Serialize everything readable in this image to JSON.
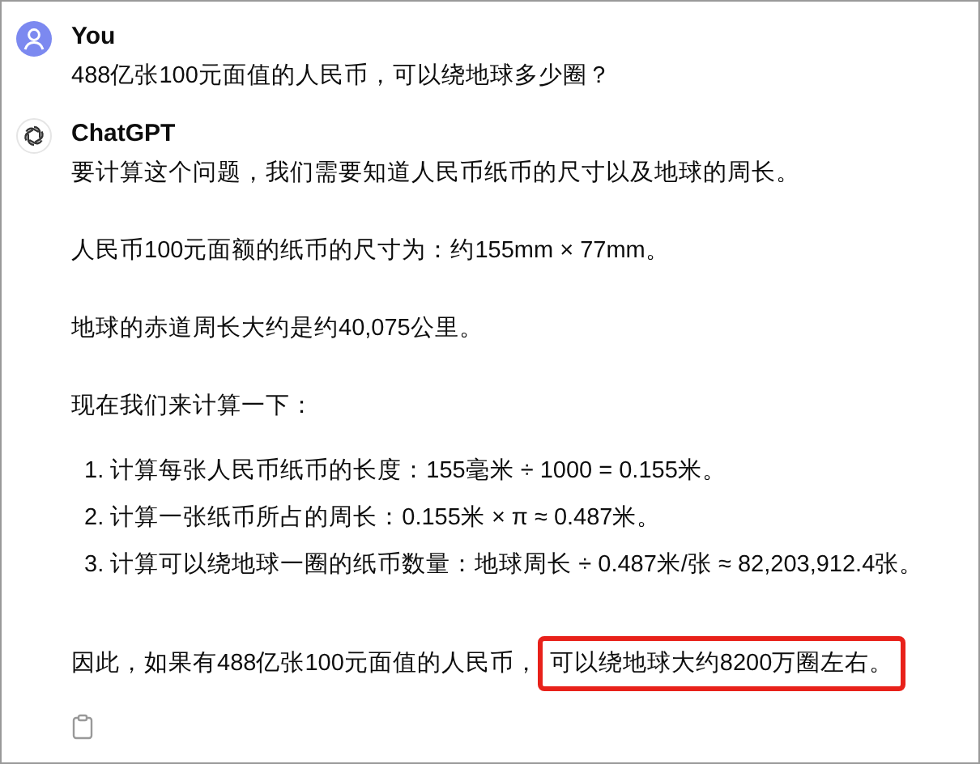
{
  "messages": [
    {
      "kind": "user",
      "author": "You",
      "paragraphs": [
        "488亿张100元面值的人民币，可以绕地球多少圈？"
      ]
    },
    {
      "kind": "assistant",
      "author": "ChatGPT",
      "paragraphs": [
        "要计算这个问题，我们需要知道人民币纸币的尺寸以及地球的周长。",
        "人民币100元面额的纸币的尺寸为：约155mm × 77mm。",
        "地球的赤道周长大约是约40,075公里。",
        "现在我们来计算一下："
      ],
      "steps": [
        {
          "number": "1.",
          "text": "计算每张人民币纸币的长度：155毫米 ÷ 1000 = 0.155米。"
        },
        {
          "number": "2.",
          "text": "计算一张纸币所占的周长：0.155米 × π ≈ 0.487米。"
        },
        {
          "number": "3.",
          "text": "计算可以绕地球一圈的纸币数量：地球周长 ÷ 0.487米/张 ≈ 82,203,912.4张。"
        }
      ],
      "conclusion": {
        "lead": "因此，如果有488亿张100元面值的人民币，",
        "highlight": "可以绕地球大约8200万圈左右。"
      }
    }
  ]
}
